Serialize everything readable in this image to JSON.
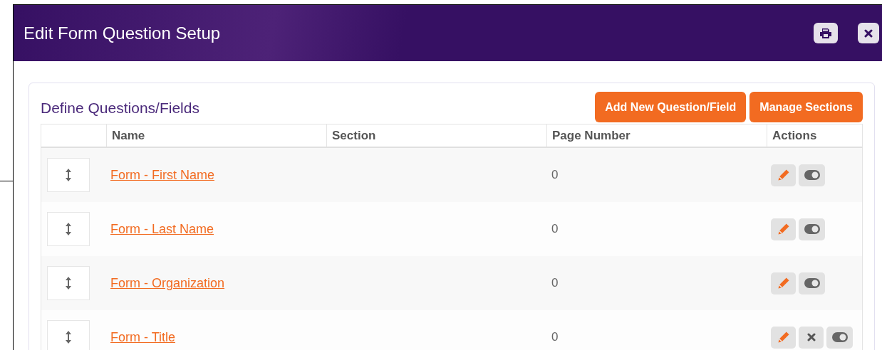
{
  "dialog": {
    "title": "Edit Form Question Setup"
  },
  "panel": {
    "title": "Define Questions/Fields",
    "buttons": [
      "Add New Question/Field",
      "Manage Sections"
    ]
  },
  "table": {
    "columns": [
      "Name",
      "Section",
      "Page Number",
      "Actions"
    ],
    "rows": [
      {
        "name": "Form - First Name",
        "page_number": "0",
        "actions": [
          {
            "kind": "edit"
          },
          {
            "kind": "toggle"
          }
        ]
      },
      {
        "name": "Form - Last Name",
        "page_number": "0",
        "actions": [
          {
            "kind": "edit"
          },
          {
            "kind": "toggle"
          }
        ]
      },
      {
        "name": "Form - Organization",
        "page_number": "0",
        "actions": [
          {
            "kind": "edit"
          },
          {
            "kind": "toggle"
          }
        ]
      },
      {
        "name": "Form - Title",
        "page_number": "0",
        "actions": [
          {
            "kind": "edit"
          },
          {
            "kind": "delete"
          },
          {
            "kind": "toggle"
          }
        ]
      }
    ]
  }
}
